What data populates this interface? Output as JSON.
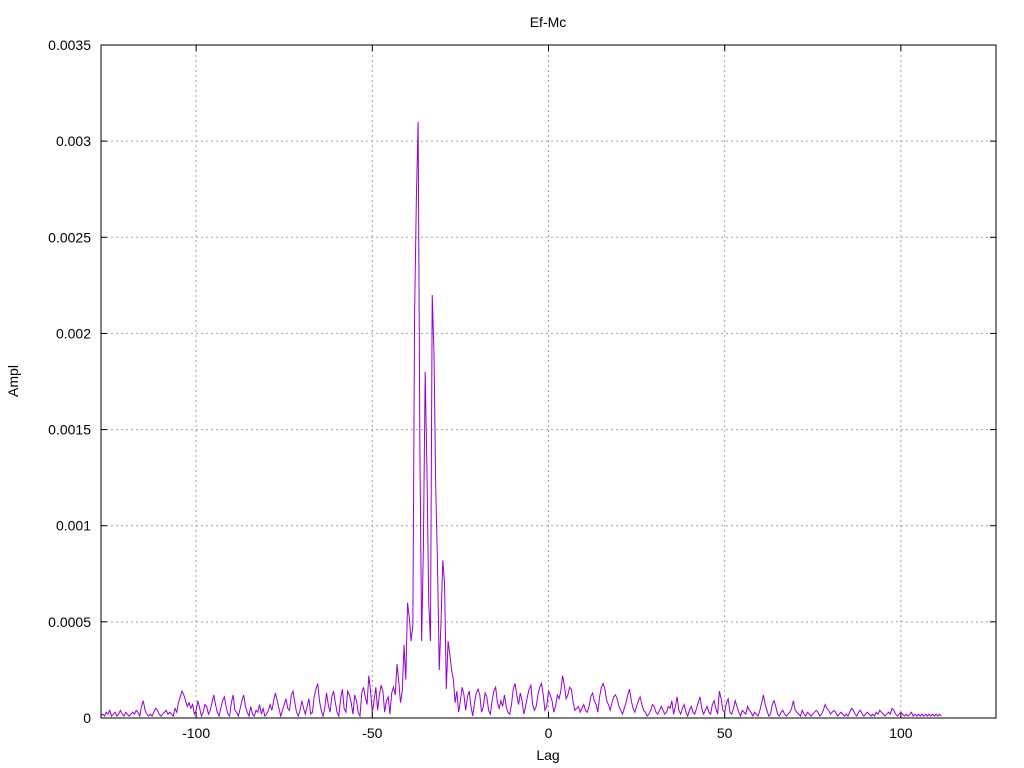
{
  "chart_data": {
    "type": "line",
    "title": "Ef-Mc",
    "xlabel": "Lag",
    "ylabel": "Ampl",
    "xlim": [
      -127,
      127
    ],
    "ylim": [
      0,
      0.0035
    ],
    "grid": true,
    "x_ticks": [
      -100,
      -50,
      0,
      50,
      100
    ],
    "x_tick_labels": [
      "-100",
      "-50",
      "0",
      "50",
      "100"
    ],
    "y_ticks": [
      0,
      0.0005,
      0.001,
      0.0015,
      0.002,
      0.0025,
      0.003,
      0.0035
    ],
    "y_tick_labels": [
      "0",
      "0.0005",
      "0.001",
      "0.0015",
      "0.002",
      "0.0025",
      "0.003",
      "0.0035"
    ],
    "series": [
      {
        "color": "#9400d3",
        "x_start": -127,
        "x_step": 0.5,
        "values": [
          1e-05,
          2e-05,
          1e-05,
          3e-05,
          2e-05,
          4e-05,
          1e-05,
          2e-05,
          3e-05,
          1e-05,
          2e-05,
          4e-05,
          2e-05,
          1e-05,
          3e-05,
          2e-05,
          1e-05,
          2e-05,
          3e-05,
          2e-05,
          4e-05,
          3e-05,
          1e-05,
          6e-05,
          9e-05,
          4e-05,
          2e-05,
          1e-05,
          2e-05,
          1e-05,
          3e-05,
          5e-05,
          4e-05,
          2e-05,
          1e-05,
          2e-05,
          3e-05,
          4e-05,
          2e-05,
          3e-05,
          2e-05,
          1e-05,
          5e-05,
          3e-05,
          8e-05,
          0.00011,
          0.00014,
          0.00012,
          9e-05,
          6e-05,
          8e-05,
          5e-05,
          7e-05,
          2e-05,
          4e-05,
          9e-05,
          5e-05,
          1e-05,
          3e-05,
          7e-05,
          6e-05,
          2e-05,
          4e-05,
          8e-05,
          0.00012,
          7e-05,
          3e-05,
          1e-05,
          5e-05,
          9e-05,
          0.00011,
          6e-05,
          2e-05,
          1e-05,
          8e-05,
          0.00012,
          4e-05,
          3e-05,
          1e-05,
          5e-05,
          9e-05,
          0.00012,
          6e-05,
          3e-05,
          1e-05,
          6e-05,
          2e-05,
          1e-05,
          4e-05,
          3e-05,
          7e-05,
          2e-05,
          5e-05,
          1e-05,
          2e-05,
          4e-05,
          7e-05,
          4e-05,
          9e-05,
          0.00013,
          9e-05,
          5e-05,
          1e-05,
          4e-05,
          7e-05,
          0.0001,
          5e-05,
          4e-05,
          0.00012,
          0.00014,
          8e-05,
          3e-05,
          1e-05,
          4e-05,
          9e-05,
          5e-05,
          2e-05,
          6e-05,
          0.0001,
          2e-05,
          3e-05,
          0.00011,
          0.00015,
          0.00018,
          9e-05,
          4e-05,
          1e-05,
          5e-05,
          0.00013,
          7e-05,
          3e-05,
          0.00011,
          0.00014,
          8e-05,
          3e-05,
          1e-05,
          0.0001,
          0.00015,
          5e-05,
          3e-05,
          0.00014,
          0.00012,
          8e-05,
          2e-05,
          0.00012,
          9e-05,
          3e-05,
          1e-05,
          0.00013,
          0.00016,
          0.00011,
          7e-05,
          0.00022,
          0.00014,
          3e-05,
          9e-05,
          0.00016,
          4e-05,
          0.00012,
          0.00017,
          0.00014,
          3e-05,
          9e-05,
          0.00011,
          2e-05,
          0.00013,
          0.00016,
          0.00012,
          0.00028,
          0.00019,
          8e-05,
          0.00014,
          0.00038,
          0.0002,
          0.0006,
          0.00052,
          0.0004,
          0.00048,
          0.0021,
          0.0027,
          0.0031,
          0.0014,
          0.0004,
          0.0009,
          0.0018,
          0.0013,
          0.0006,
          0.0004,
          0.0022,
          0.0019,
          0.0012,
          0.0008,
          0.00025,
          0.0005,
          0.00082,
          0.0007,
          0.00015,
          0.0004,
          0.00033,
          0.00025,
          0.0002,
          8e-05,
          0.00014,
          3e-05,
          9e-05,
          0.00016,
          0.00012,
          4e-05,
          0.00011,
          0.00014,
          6e-05,
          1e-05,
          8e-05,
          0.00013,
          0.00015,
          0.00012,
          3e-05,
          6e-05,
          0.00013,
          0.00011,
          4e-05,
          2e-05,
          9e-05,
          0.00014,
          0.00016,
          8e-05,
          5e-05,
          9e-05,
          6e-05,
          0.00012,
          6e-05,
          3e-05,
          2e-05,
          7e-05,
          0.00015,
          0.00018,
          0.00012,
          7e-05,
          0.00013,
          9e-05,
          2e-05,
          6e-05,
          0.00011,
          0.00015,
          0.00017,
          7e-05,
          4e-05,
          6e-05,
          0.00012,
          0.00016,
          0.00018,
          0.00012,
          4e-05,
          6e-05,
          0.00014,
          0.00012,
          9e-05,
          3e-05,
          6e-05,
          0.00012,
          0.0001,
          0.00014,
          0.00022,
          0.00017,
          0.0001,
          0.00012,
          0.00016,
          0.00015,
          8e-05,
          4e-05,
          5e-05,
          6e-05,
          3e-05,
          5e-05,
          7e-05,
          4e-05,
          3e-05,
          6e-05,
          0.00011,
          0.00013,
          9e-05,
          7e-05,
          3e-05,
          0.00011,
          0.00016,
          0.00018,
          0.00015,
          9e-05,
          7e-05,
          4e-05,
          8e-05,
          0.00011,
          0.00012,
          0.0001,
          6e-05,
          4e-05,
          2e-05,
          5e-05,
          8e-05,
          0.00012,
          0.00015,
          9e-05,
          5e-05,
          3e-05,
          6e-05,
          9e-05,
          0.00011,
          7e-05,
          4e-05,
          3e-05,
          1e-05,
          2e-05,
          4e-05,
          7e-05,
          6e-05,
          3e-05,
          2e-05,
          4e-05,
          6e-05,
          4e-05,
          2e-05,
          3e-05,
          6e-05,
          5e-05,
          9e-05,
          2e-05,
          6e-05,
          0.00011,
          4e-05,
          2e-05,
          5e-05,
          7e-05,
          3e-05,
          1e-05,
          4e-05,
          6e-05,
          3e-05,
          2e-05,
          5e-05,
          8e-05,
          0.00011,
          5e-05,
          2e-05,
          4e-05,
          6e-05,
          3e-05,
          2e-05,
          7e-05,
          9e-05,
          5e-05,
          2e-05,
          0.00014,
          0.0001,
          4e-05,
          3e-05,
          8e-05,
          0.0001,
          3e-05,
          2e-05,
          5e-05,
          9e-05,
          6e-05,
          3e-05,
          1e-05,
          4e-05,
          3e-05,
          2e-05,
          6e-05,
          4e-05,
          3e-05,
          1e-05,
          3e-05,
          2e-05,
          1e-05,
          4e-05,
          8e-05,
          0.00012,
          7e-05,
          4e-05,
          1e-05,
          2e-05,
          7e-05,
          9e-05,
          6e-05,
          2e-05,
          1e-05,
          3e-05,
          4e-05,
          2e-05,
          1e-05,
          2e-05,
          3e-05,
          5e-05,
          9e-05,
          4e-05,
          3e-05,
          2e-05,
          1e-05,
          4e-05,
          2e-05,
          1e-05,
          3e-05,
          2e-05,
          1e-05,
          2e-05,
          3e-05,
          4e-05,
          3e-05,
          1e-05,
          2e-05,
          4e-05,
          7e-05,
          5e-05,
          4e-05,
          2e-05,
          3e-05,
          4e-05,
          3e-05,
          1e-05,
          2e-05,
          3e-05,
          2e-05,
          1e-05,
          2e-05,
          1e-05,
          3e-05,
          5e-05,
          4e-05,
          2e-05,
          1e-05,
          3e-05,
          4e-05,
          2e-05,
          1e-05,
          2e-05,
          3e-05,
          2e-05,
          1e-05,
          2e-05,
          1e-05,
          3e-05,
          2e-05,
          4e-05,
          3e-05,
          2e-05,
          1e-05,
          2e-05,
          3e-05,
          2e-05,
          5e-05,
          4e-05,
          2e-05,
          1e-05,
          2e-05,
          3e-05,
          2e-05,
          1e-05,
          2e-05,
          1e-05,
          2e-05,
          3e-05,
          1e-05,
          2e-05,
          1e-05,
          2e-05,
          1e-05,
          2e-05,
          1e-05,
          2e-05,
          1e-05,
          2e-05,
          1e-05,
          2e-05,
          1e-05,
          2e-05,
          1e-05,
          2e-05,
          1e-05
        ]
      }
    ]
  }
}
